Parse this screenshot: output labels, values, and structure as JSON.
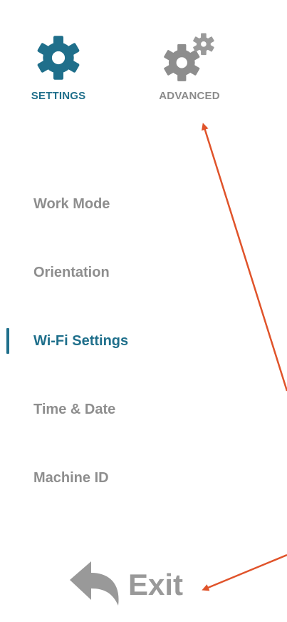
{
  "tabs": {
    "settings": {
      "label": "SETTINGS",
      "active": true
    },
    "advanced": {
      "label": "ADVANCED",
      "active": false
    }
  },
  "menu": {
    "items": [
      {
        "label": "Work Mode",
        "active": false
      },
      {
        "label": "Orientation",
        "active": false
      },
      {
        "label": "Wi-Fi Settings",
        "active": true
      },
      {
        "label": "Time & Date",
        "active": false
      },
      {
        "label": "Machine ID",
        "active": false
      }
    ]
  },
  "exit": {
    "label": "Exit"
  },
  "colors": {
    "accent": "#1f6f8b",
    "inactive_text": "#8e8e8e",
    "exit_gray": "#999999",
    "annotation_arrow": "#e0532a"
  },
  "icons": {
    "settings_tab": "gear-icon",
    "advanced_tab": "gears-icon",
    "exit": "undo-arrow-icon"
  }
}
